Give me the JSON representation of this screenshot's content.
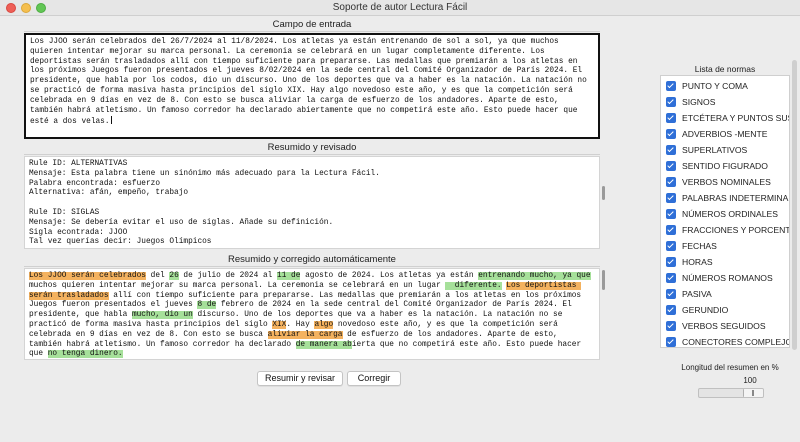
{
  "window": {
    "title": "Soporte de autor Lectura Fácil"
  },
  "input_section": {
    "label": "Campo de entrada",
    "text": "Los JJOO serán celebrados del 26/7/2024 al 11/8/2024. Los atletas ya están entrenando de sol a sol, ya que muchos quieren intentar mejorar su marca personal. La ceremonia se celebrará en un lugar completamente diferente. Los deportistas serán trasladados allí con tiempo suficiente para prepararse. Las medallas que premiarán a los atletas en los próximos Juegos fueron presentados el jueves 8/02/2024 en la sede central del Comité Organizador de París 2024. El presidente, que habla por los codos, dio un discurso. Uno de los deportes que va a haber es la natación. La natación no se practicó de forma masiva hasta principios del siglo XIX. Hay algo novedoso este año, y es que la competición será celebrada en 9 días en vez de 8. Con esto se busca aliviar la carga de esfuerzo de los andadores. Aparte de esto, también habrá atletismo. Un famoso corredor ha declarado abiertamente que no competirá este año. Esto puede hacer que esté a dos velas."
  },
  "summary_section": {
    "label": "Resumido y revisado",
    "text": "Rule ID: ALTERNATIVAS\nMensaje: Esta palabra tiene un sinónimo más adecuado para la Lectura Fácil.\nPalabra encontrada: esfuerzo\nAlternativa: afán, empeño, trabajo\n\nRule ID: SIGLAS\nMensaje: Se debería evitar el uso de siglas. Añade su definición.\nSigla econtrada: JJOO\nTal vez querías decir: Juegos Olímpicos\n\nRule ID: DEFINICIONES"
  },
  "corrected_section": {
    "label": "Resumido y corregido automáticamente",
    "segments": [
      {
        "text": "Los JJOO serán celebrados",
        "hl": "orange"
      },
      {
        "text": " del ",
        "hl": ""
      },
      {
        "text": "26",
        "hl": "green"
      },
      {
        "text": " de julio de 2024 al ",
        "hl": ""
      },
      {
        "text": "11",
        "hl": "green"
      },
      {
        "text": " de",
        "hl": "green"
      },
      {
        "text": " agosto de 2024. Los atletas ya están ",
        "hl": ""
      },
      {
        "text": "entrenando mucho, ya que",
        "hl": "green"
      },
      {
        "text": " muchos quieren intentar mejorar su marca personal. La ceremonia se celebrará en un lugar ",
        "hl": ""
      },
      {
        "text": "  diferente.",
        "hl": "green"
      },
      {
        "text": " ",
        "hl": ""
      },
      {
        "text": "Los deportistas serán trasladados",
        "hl": "orange"
      },
      {
        "text": " allí con tiempo suficiente para prepararse. Las medallas que premiarán a los atletas en los próximos Juegos fueron presentados el jueves ",
        "hl": ""
      },
      {
        "text": "8",
        "hl": "green"
      },
      {
        "text": " de",
        "hl": "green"
      },
      {
        "text": " febrero de 2024 en la sede central del Comité Organizador de París 2024. El presidente, que habla ",
        "hl": ""
      },
      {
        "text": "mucho, dio un",
        "hl": "green"
      },
      {
        "text": " discurso. Uno de los deportes que va a haber es la natación. La natación no se practicó de forma masiva hasta principios del siglo ",
        "hl": ""
      },
      {
        "text": "XIX",
        "hl": "orange"
      },
      {
        "text": ". Hay ",
        "hl": ""
      },
      {
        "text": "algo",
        "hl": "orange"
      },
      {
        "text": " novedoso este año, y es que la competición será celebrada en 9 días en vez de 8. Con esto se busca ",
        "hl": ""
      },
      {
        "text": "aliviar la carga",
        "hl": "orange"
      },
      {
        "text": " de esfuerzo de los andadores. Aparte de esto, también habrá atletismo. Un famoso corredor ha declarado ",
        "hl": ""
      },
      {
        "text": "de manera ab",
        "hl": "green"
      },
      {
        "text": "ierta que no competirá este año. Esto puede hacer que ",
        "hl": ""
      },
      {
        "text": "no tenga dinero.",
        "hl": "green"
      }
    ]
  },
  "buttons": {
    "summarize_label": "Resumir y revisar",
    "correct_label": "Corregir"
  },
  "rules_panel": {
    "label": "Lista de normas",
    "items": [
      "PUNTO Y COMA",
      "SIGNOS",
      "ETCÉTERA Y PUNTOS SUSPENSIVOS",
      "ADVERBIOS -MENTE",
      "SUPERLATIVOS",
      "SENTIDO FIGURADO",
      "VERBOS NOMINALES",
      "PALABRAS INDETERMINADAS",
      "NÚMEROS ORDINALES",
      "FRACCIONES Y PORCENTAJES",
      "FECHAS",
      "HORAS",
      "NÚMEROS ROMANOS",
      "PASIVA",
      "GERUNDIO",
      "VERBOS SEGUIDOS",
      "CONECTORES COMPLEJOS"
    ]
  },
  "summary_length": {
    "label": "Longitud del resumen en %",
    "value": "100",
    "percent": 100
  },
  "colors": {
    "highlight_orange": "#f4b25f",
    "highlight_green": "#a6e09a",
    "checkbox_blue": "#2f6fd7"
  }
}
